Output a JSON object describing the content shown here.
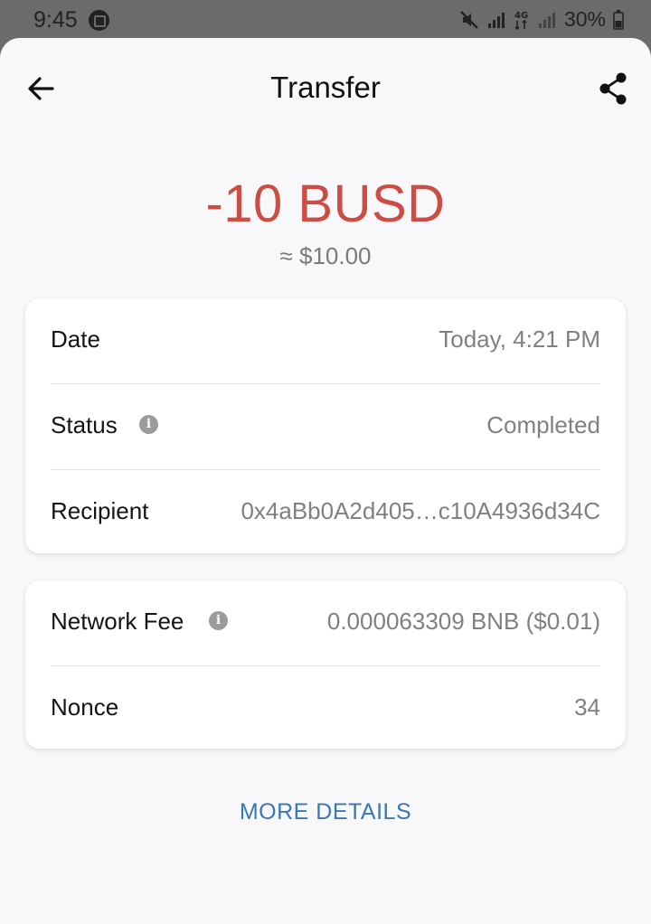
{
  "status_bar": {
    "time": "9:45",
    "battery": "30%",
    "icons": [
      "notification-icon",
      "mute-icon",
      "signal-icon",
      "4g-icon",
      "signal-icon",
      "battery-icon"
    ]
  },
  "header": {
    "title": "Transfer",
    "back_icon": "arrow-left-icon",
    "share_icon": "share-icon"
  },
  "amount": {
    "value": "-10 BUSD",
    "fiat": "≈ $10.00",
    "color": "#cc4d44"
  },
  "details": [
    {
      "label": "Date",
      "value": "Today, 4:21 PM",
      "info": false
    },
    {
      "label": "Status",
      "value": "Completed",
      "info": true
    },
    {
      "label": "Recipient",
      "value": "0x4aBb0A2d405…c10A4936d34C",
      "info": false
    }
  ],
  "fees": [
    {
      "label": "Network Fee",
      "value": "0.000063309 BNB ($0.01)",
      "info": true
    },
    {
      "label": "Nonce",
      "value": "34",
      "info": false
    }
  ],
  "more_details_label": "MORE DETAILS",
  "colors": {
    "accent": "#3a77b5",
    "negative": "#cc4d44"
  }
}
